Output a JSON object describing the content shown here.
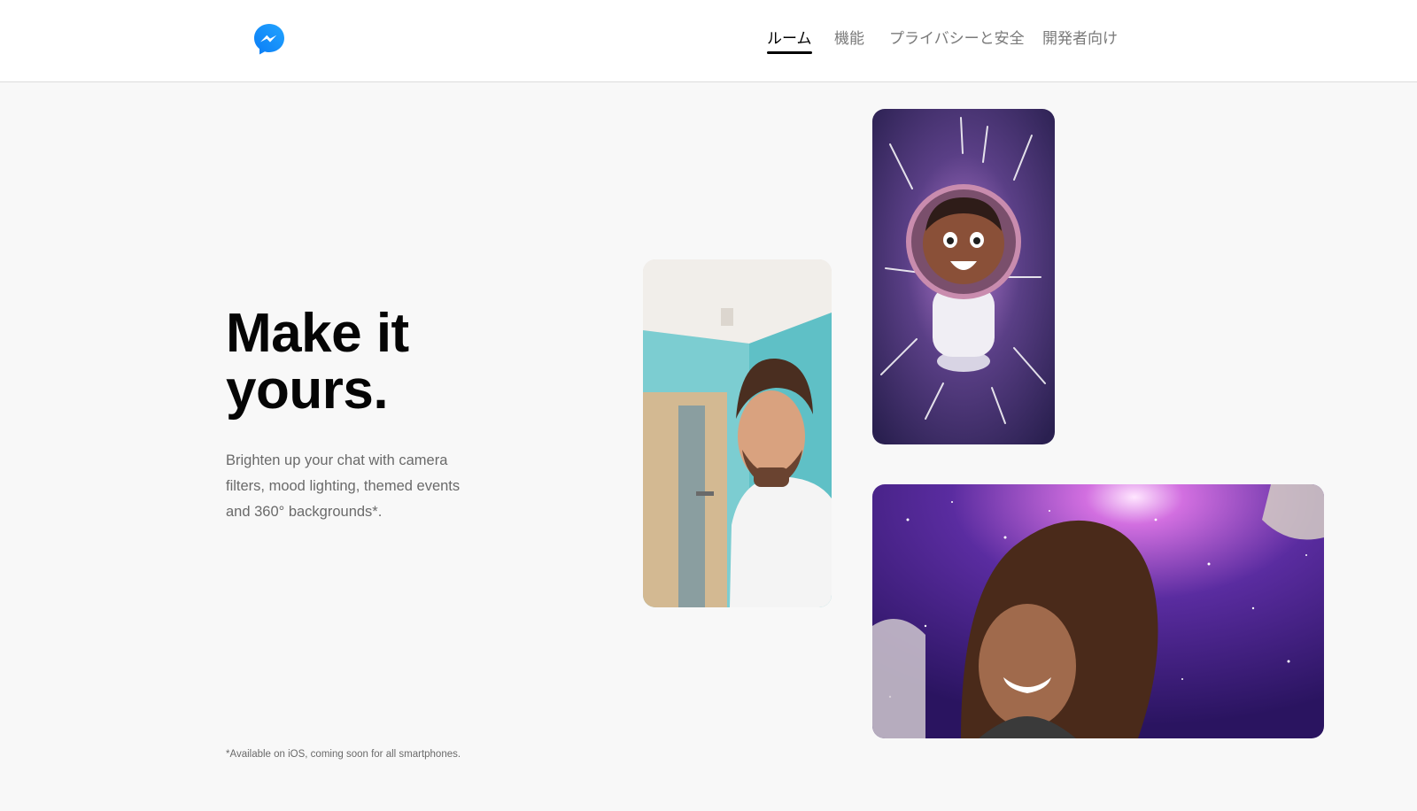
{
  "header": {
    "nav": [
      {
        "label": "ルーム",
        "active": true
      },
      {
        "label": "機能",
        "active": false
      },
      {
        "label": "プライバシーと安全",
        "active": false
      },
      {
        "label": "開発者向け",
        "active": false
      }
    ]
  },
  "hero": {
    "headline_line1": "Make it",
    "headline_line2": "yours.",
    "description": "Brighten up your chat with camera filters, mood lighting, themed events and 360° backgrounds*.",
    "footnote": "*Available on iOS, coming soon for all smartphones."
  },
  "colors": {
    "brand_blue": "#0a8cfa",
    "page_bg": "#f8f8f8",
    "nav_active": "#000000",
    "nav_inactive": "#7a7a7a"
  },
  "icons": {
    "logo": "messenger-logo-icon"
  }
}
